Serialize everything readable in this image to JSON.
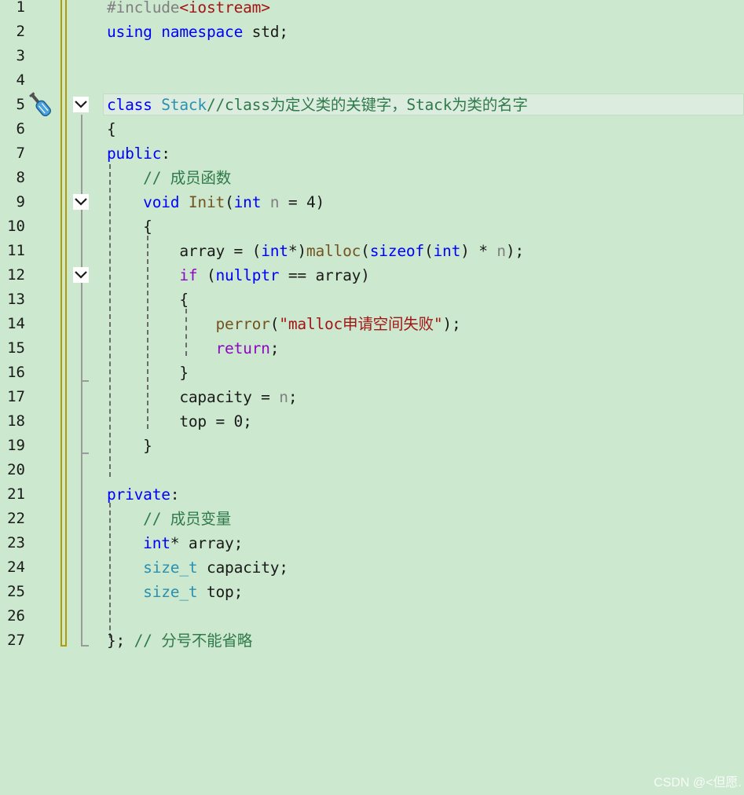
{
  "colors": {
    "background": "#cce8cf",
    "keyword": "#0000ff",
    "control": "#8f08c4",
    "comment": "#2f7a4b",
    "string": "#a31515",
    "function": "#74531f",
    "type": "#2b91af",
    "param": "#808080",
    "preprocessor": "#808080",
    "plain": "#1a1a1a"
  },
  "editor": {
    "current_line": 5,
    "quick_action_icon": "screwdriver-icon",
    "fold_icon": "chevron-down-icon",
    "lines": [
      {
        "n": "1",
        "fold": false,
        "tokens": [
          {
            "t": "#include",
            "c": "preprocessor"
          },
          {
            "t": "<iostream>",
            "c": "string"
          }
        ]
      },
      {
        "n": "2",
        "fold": false,
        "tokens": [
          {
            "t": "using",
            "c": "keyword"
          },
          {
            "t": " ",
            "c": "plain"
          },
          {
            "t": "namespace",
            "c": "keyword"
          },
          {
            "t": " std;",
            "c": "plain"
          }
        ]
      },
      {
        "n": "3",
        "fold": false,
        "tokens": []
      },
      {
        "n": "4",
        "fold": false,
        "tokens": []
      },
      {
        "n": "5",
        "fold": true,
        "tokens": [
          {
            "t": "class",
            "c": "keyword"
          },
          {
            "t": " ",
            "c": "plain"
          },
          {
            "t": "Stack",
            "c": "type"
          },
          {
            "t": "//class为定义类的关键字，Stack为类的名字",
            "c": "comment"
          }
        ]
      },
      {
        "n": "6",
        "fold": false,
        "tokens": [
          {
            "t": "{",
            "c": "plain"
          }
        ]
      },
      {
        "n": "7",
        "fold": false,
        "tokens": [
          {
            "t": "public",
            "c": "keyword"
          },
          {
            "t": ":",
            "c": "plain"
          }
        ]
      },
      {
        "n": "8",
        "fold": false,
        "tokens": [
          {
            "t": "    ",
            "c": "plain"
          },
          {
            "t": "// 成员函数",
            "c": "comment"
          }
        ]
      },
      {
        "n": "9",
        "fold": true,
        "tokens": [
          {
            "t": "    ",
            "c": "plain"
          },
          {
            "t": "void",
            "c": "keyword"
          },
          {
            "t": " ",
            "c": "plain"
          },
          {
            "t": "Init",
            "c": "function"
          },
          {
            "t": "(",
            "c": "plain"
          },
          {
            "t": "int",
            "c": "keyword"
          },
          {
            "t": " ",
            "c": "plain"
          },
          {
            "t": "n",
            "c": "param"
          },
          {
            "t": " = 4)",
            "c": "plain"
          }
        ]
      },
      {
        "n": "10",
        "fold": false,
        "tokens": [
          {
            "t": "    {",
            "c": "plain"
          }
        ]
      },
      {
        "n": "11",
        "fold": false,
        "tokens": [
          {
            "t": "        array = (",
            "c": "plain"
          },
          {
            "t": "int",
            "c": "keyword"
          },
          {
            "t": "*)",
            "c": "plain"
          },
          {
            "t": "malloc",
            "c": "function"
          },
          {
            "t": "(",
            "c": "plain"
          },
          {
            "t": "sizeof",
            "c": "keyword"
          },
          {
            "t": "(",
            "c": "plain"
          },
          {
            "t": "int",
            "c": "keyword"
          },
          {
            "t": ") * ",
            "c": "plain"
          },
          {
            "t": "n",
            "c": "param"
          },
          {
            "t": ");",
            "c": "plain"
          }
        ]
      },
      {
        "n": "12",
        "fold": true,
        "tokens": [
          {
            "t": "        ",
            "c": "plain"
          },
          {
            "t": "if",
            "c": "control"
          },
          {
            "t": " (",
            "c": "plain"
          },
          {
            "t": "nullptr",
            "c": "keyword"
          },
          {
            "t": " == array)",
            "c": "plain"
          }
        ]
      },
      {
        "n": "13",
        "fold": false,
        "tokens": [
          {
            "t": "        {",
            "c": "plain"
          }
        ]
      },
      {
        "n": "14",
        "fold": false,
        "tokens": [
          {
            "t": "            ",
            "c": "plain"
          },
          {
            "t": "perror",
            "c": "function"
          },
          {
            "t": "(",
            "c": "plain"
          },
          {
            "t": "\"malloc申请空间失败\"",
            "c": "string"
          },
          {
            "t": ");",
            "c": "plain"
          }
        ]
      },
      {
        "n": "15",
        "fold": false,
        "tokens": [
          {
            "t": "            ",
            "c": "plain"
          },
          {
            "t": "return",
            "c": "control"
          },
          {
            "t": ";",
            "c": "plain"
          }
        ]
      },
      {
        "n": "16",
        "fold": false,
        "tokens": [
          {
            "t": "        }",
            "c": "plain"
          }
        ]
      },
      {
        "n": "17",
        "fold": false,
        "tokens": [
          {
            "t": "        capacity = ",
            "c": "plain"
          },
          {
            "t": "n",
            "c": "param"
          },
          {
            "t": ";",
            "c": "plain"
          }
        ]
      },
      {
        "n": "18",
        "fold": false,
        "tokens": [
          {
            "t": "        top = 0;",
            "c": "plain"
          }
        ]
      },
      {
        "n": "19",
        "fold": false,
        "tokens": [
          {
            "t": "    }",
            "c": "plain"
          }
        ]
      },
      {
        "n": "20",
        "fold": false,
        "tokens": []
      },
      {
        "n": "21",
        "fold": false,
        "tokens": [
          {
            "t": "private",
            "c": "keyword"
          },
          {
            "t": ":",
            "c": "plain"
          }
        ]
      },
      {
        "n": "22",
        "fold": false,
        "tokens": [
          {
            "t": "    ",
            "c": "plain"
          },
          {
            "t": "// 成员变量",
            "c": "comment"
          }
        ]
      },
      {
        "n": "23",
        "fold": false,
        "tokens": [
          {
            "t": "    ",
            "c": "plain"
          },
          {
            "t": "int",
            "c": "keyword"
          },
          {
            "t": "* array;",
            "c": "plain"
          }
        ]
      },
      {
        "n": "24",
        "fold": false,
        "tokens": [
          {
            "t": "    ",
            "c": "plain"
          },
          {
            "t": "size_t",
            "c": "type"
          },
          {
            "t": " capacity;",
            "c": "plain"
          }
        ]
      },
      {
        "n": "25",
        "fold": false,
        "tokens": [
          {
            "t": "    ",
            "c": "plain"
          },
          {
            "t": "size_t",
            "c": "type"
          },
          {
            "t": " top;",
            "c": "plain"
          }
        ]
      },
      {
        "n": "26",
        "fold": false,
        "tokens": []
      },
      {
        "n": "27",
        "fold": false,
        "tokens": [
          {
            "t": "}; ",
            "c": "plain"
          },
          {
            "t": "// 分号不能省略",
            "c": "comment"
          }
        ]
      }
    ]
  },
  "watermark": "CSDN @<但愿."
}
